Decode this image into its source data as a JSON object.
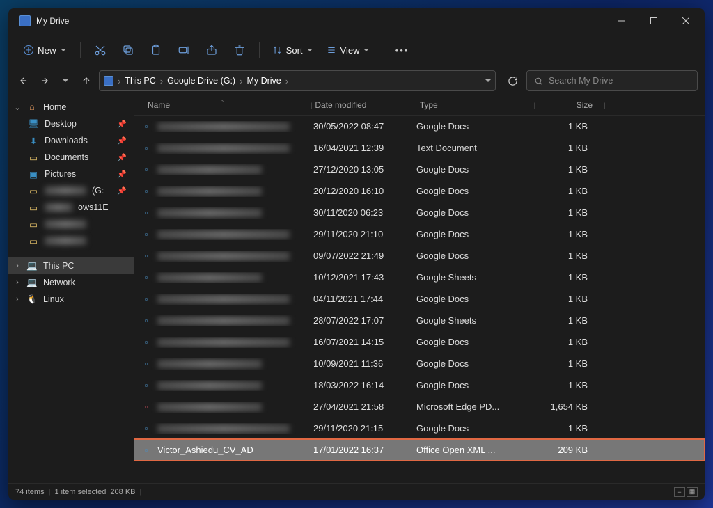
{
  "window": {
    "title": "My Drive"
  },
  "toolbar": {
    "new_label": "New",
    "sort_label": "Sort",
    "view_label": "View"
  },
  "breadcrumb": [
    "This PC",
    "Google Drive (G:)",
    "My Drive"
  ],
  "search": {
    "placeholder": "Search My Drive"
  },
  "sidebar": {
    "home": "Home",
    "desktop": "Desktop",
    "downloads": "Downloads",
    "documents": "Documents",
    "pictures": "Pictures",
    "ows11_suffix": "ows11E",
    "drive_g_suffix": " (G:",
    "this_pc": "This PC",
    "network": "Network",
    "linux": "Linux"
  },
  "columns": {
    "name": "Name",
    "date": "Date modified",
    "type": "Type",
    "size": "Size"
  },
  "files": [
    {
      "blurred": true,
      "date": "30/05/2022 08:47",
      "type": "Google Docs",
      "size": "1 KB"
    },
    {
      "blurred": true,
      "date": "16/04/2021 12:39",
      "type": "Text Document",
      "size": "1 KB"
    },
    {
      "blurred": true,
      "date": "27/12/2020 13:05",
      "type": "Google Docs",
      "size": "1 KB"
    },
    {
      "blurred": true,
      "date": "20/12/2020 16:10",
      "type": "Google Docs",
      "size": "1 KB"
    },
    {
      "blurred": true,
      "date": "30/11/2020 06:23",
      "type": "Google Docs",
      "size": "1 KB"
    },
    {
      "blurred": true,
      "date": "29/11/2020 21:10",
      "type": "Google Docs",
      "size": "1 KB"
    },
    {
      "blurred": true,
      "date": "09/07/2022 21:49",
      "type": "Google Docs",
      "size": "1 KB"
    },
    {
      "blurred": true,
      "date": "10/12/2021 17:43",
      "type": "Google Sheets",
      "size": "1 KB"
    },
    {
      "blurred": true,
      "date": "04/11/2021 17:44",
      "type": "Google Docs",
      "size": "1 KB"
    },
    {
      "blurred": true,
      "date": "28/07/2022 17:07",
      "type": "Google Sheets",
      "size": "1 KB"
    },
    {
      "blurred": true,
      "date": "16/07/2021 14:15",
      "type": "Google Docs",
      "size": "1 KB"
    },
    {
      "blurred": true,
      "date": "10/09/2021 11:36",
      "type": "Google Docs",
      "size": "1 KB"
    },
    {
      "blurred": true,
      "date": "18/03/2022 16:14",
      "type": "Google Docs",
      "size": "1 KB"
    },
    {
      "blurred": true,
      "date": "27/04/2021 21:58",
      "type": "Microsoft Edge PD...",
      "size": "1,654 KB",
      "ico": "pdf"
    },
    {
      "blurred": true,
      "date": "29/11/2020 21:15",
      "type": "Google Docs",
      "size": "1 KB"
    },
    {
      "name": "Victor_Ashiedu_CV_AD",
      "date": "17/01/2022 16:37",
      "type": "Office Open XML ...",
      "size": "209 KB",
      "selected": true,
      "highlighted": true
    }
  ],
  "status": {
    "items": "74 items",
    "selected": "1 item selected",
    "size": "208 KB"
  }
}
